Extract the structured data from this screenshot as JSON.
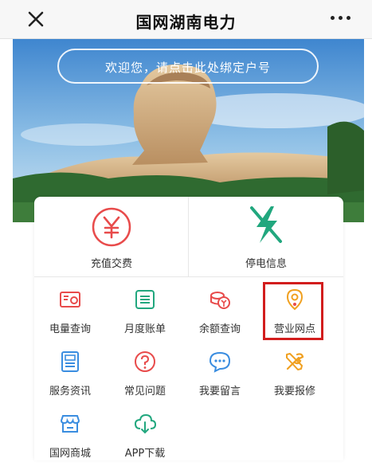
{
  "header": {
    "title": "国网湖南电力",
    "close_icon": "close-icon",
    "more_icon": "more-icon"
  },
  "banner": {
    "bind_prompt": "欢迎您，请点击此处绑定户号"
  },
  "quick_actions": [
    {
      "label": "充值交费",
      "icon": "yuan-icon",
      "color": "#e84b4b"
    },
    {
      "label": "停电信息",
      "icon": "power-outage-icon",
      "color": "#21a77e"
    }
  ],
  "services": [
    {
      "label": "电量查询",
      "icon": "meter-icon",
      "color": "#e84b4b"
    },
    {
      "label": "月度账单",
      "icon": "bill-icon",
      "color": "#21a77e"
    },
    {
      "label": "余额查询",
      "icon": "coins-icon",
      "color": "#e84b4b"
    },
    {
      "label": "营业网点",
      "icon": "location-pin-icon",
      "color": "#f0a020"
    },
    {
      "label": "服务资讯",
      "icon": "news-icon",
      "color": "#3a8de0"
    },
    {
      "label": "常见问题",
      "icon": "question-icon",
      "color": "#e84b4b"
    },
    {
      "label": "我要留言",
      "icon": "chat-icon",
      "color": "#3a8de0"
    },
    {
      "label": "我要报修",
      "icon": "repair-tools-icon",
      "color": "#f0a020"
    },
    {
      "label": "国网商城",
      "icon": "store-icon",
      "color": "#3a8de0"
    },
    {
      "label": "APP下载",
      "icon": "cloud-download-icon",
      "color": "#21a77e"
    }
  ],
  "highlighted_service": "营业网点"
}
